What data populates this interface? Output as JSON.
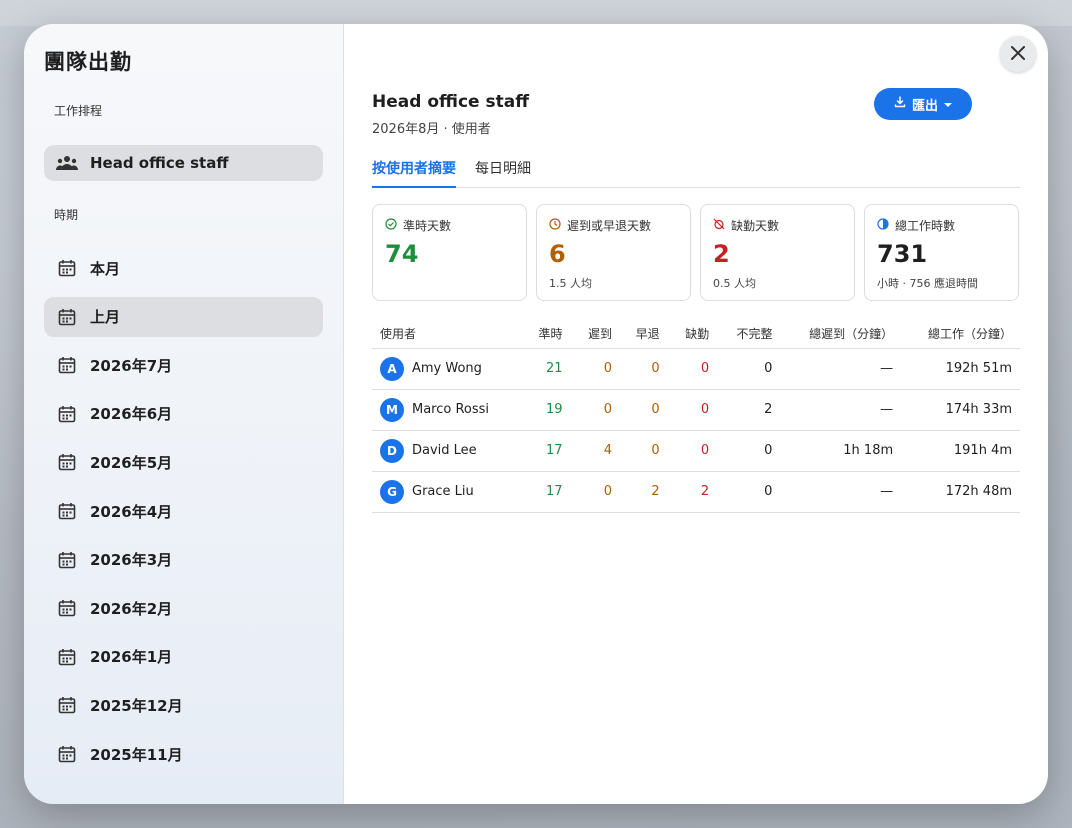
{
  "sidebar": {
    "title": "團隊出勤",
    "schedule_label": "工作排程",
    "schedule_item": "Head office staff",
    "period_label": "時期",
    "periods": [
      "本月",
      "上月",
      "2026年7月",
      "2026年6月",
      "2026年5月",
      "2026年4月",
      "2026年3月",
      "2026年2月",
      "2026年1月",
      "2025年12月",
      "2025年11月"
    ],
    "active_period_index": 1
  },
  "header": {
    "title": "Head office staff",
    "subtitle": "2026年8月 · 使用者",
    "export_label": "匯出"
  },
  "tabs": [
    "按使用者摘要",
    "每日明細"
  ],
  "cards": [
    {
      "label": "準時天數",
      "value": "74",
      "note": "",
      "color": "#1e8e3e"
    },
    {
      "label": "遲到或早退天數",
      "value": "6",
      "note": "1.5 人均",
      "color": "#b06000"
    },
    {
      "label": "缺勤天數",
      "value": "2",
      "note": "0.5 人均",
      "color": "#c5221f"
    },
    {
      "label": "總工作時數",
      "value": "731",
      "note": "小時 · 756 應退時間",
      "color": "#1f1f1f"
    }
  ],
  "table": {
    "columns": [
      "使用者",
      "準時",
      "遲到",
      "早退",
      "缺勤",
      "不完整",
      "總遲到（分鐘）",
      "總工作（分鐘）"
    ],
    "rows": [
      {
        "initial": "A",
        "name": "Amy Wong",
        "on_time": "21",
        "late": "0",
        "early": "0",
        "absent": "0",
        "incomplete": "0",
        "total_late": "—",
        "total_work": "192h 51m"
      },
      {
        "initial": "M",
        "name": "Marco Rossi",
        "on_time": "19",
        "late": "0",
        "early": "0",
        "absent": "0",
        "incomplete": "2",
        "total_late": "—",
        "total_work": "174h 33m"
      },
      {
        "initial": "D",
        "name": "David Lee",
        "on_time": "17",
        "late": "4",
        "early": "0",
        "absent": "0",
        "incomplete": "0",
        "total_late": "1h 18m",
        "total_work": "191h 4m"
      },
      {
        "initial": "G",
        "name": "Grace Liu",
        "on_time": "17",
        "late": "0",
        "early": "2",
        "absent": "2",
        "incomplete": "0",
        "total_late": "—",
        "total_work": "172h 48m"
      }
    ]
  },
  "colors": {
    "accent": "#1a73e8",
    "green": "#1e8e3e",
    "amber": "#b06000",
    "red": "#c5221f"
  }
}
